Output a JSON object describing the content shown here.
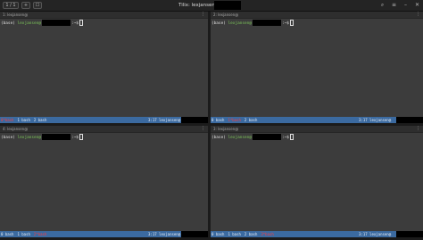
{
  "window": {
    "title": "Tilix: lexjansen@",
    "buttons": [
      "1 / 1",
      "+",
      "☐"
    ],
    "controls": [
      "search-icon",
      "menu-icon",
      "minimize-icon",
      "close-icon"
    ]
  },
  "panes": [
    {
      "header": "1: lexjansen@",
      "prompt_prefix": "(base) ",
      "user": "lexjansen@",
      "prompt_suffix": ":~$",
      "windows": [
        {
          "label": "0*bash",
          "active": true
        },
        {
          "label": "1 bash",
          "active": false
        },
        {
          "label": "2 bash",
          "active": false
        }
      ],
      "status_right": "3:17 lexjansen@"
    },
    {
      "header": "2: lexjansen@",
      "prompt_prefix": "(base) ",
      "user": "lexjansen@",
      "prompt_suffix": ":~$",
      "windows": [
        {
          "label": "0 bash",
          "active": false
        },
        {
          "label": "1*bash",
          "active": true
        },
        {
          "label": "2 bash",
          "active": false
        }
      ],
      "status_right": "3:17 lexjansen@"
    },
    {
      "header": "4: lexjansen@",
      "prompt_prefix": "(base) ",
      "user": "lexjansen@",
      "prompt_suffix": ":~$",
      "windows": [
        {
          "label": "0 bash",
          "active": false
        },
        {
          "label": "1 bash",
          "active": false
        },
        {
          "label": "2*bash",
          "active": true
        }
      ],
      "status_right": "3:17 lexjansen@"
    },
    {
      "header": "3: lexjansen@",
      "prompt_prefix": "(base) ",
      "user": "lexjansen@",
      "prompt_suffix": ":~$",
      "windows": [
        {
          "label": "0 bash",
          "active": false
        },
        {
          "label": "1 bash",
          "active": false
        },
        {
          "label": "2 bash",
          "active": false
        },
        {
          "label": "3*bash",
          "active": true
        }
      ],
      "status_right": "3:17 lexjansen@"
    }
  ]
}
